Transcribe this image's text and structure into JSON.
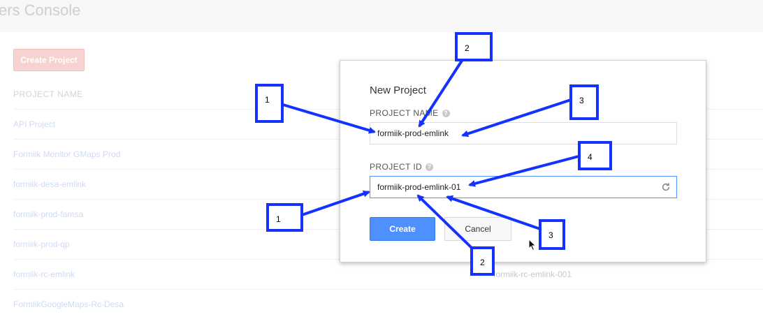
{
  "app": {
    "title": "ers Console"
  },
  "toolbar": {
    "create_project_label": "Create Project"
  },
  "project_list": {
    "column_header": "PROJECT NAME",
    "items": [
      "API Project",
      "Formiik Monitor GMaps Prod",
      "formiik-desa-emlink",
      "formiik-prod-famsa",
      "formiik-prod-qp",
      "formiik-rc-emlink",
      "FormiikGoogleMaps-Rc-Desa"
    ],
    "visible_id": "formiik-rc-emlink-001"
  },
  "dialog": {
    "title": "New Project",
    "project_name_label": "PROJECT NAME",
    "project_name_value": "formiik-prod-emlink",
    "project_id_label": "PROJECT ID",
    "project_id_value": "formiik-prod-emlink-01",
    "create_label": "Create",
    "cancel_label": "Cancel"
  },
  "annotations": {
    "callout_a": "1",
    "callout_b": "2",
    "callout_c": "3",
    "callout_d": "4",
    "callout_e": "1",
    "callout_f": "2",
    "callout_g": "3"
  },
  "colors": {
    "annotation_blue": "#1432ff",
    "primary_button": "#4d90fe",
    "create_project_button": "#f6d3d0"
  }
}
